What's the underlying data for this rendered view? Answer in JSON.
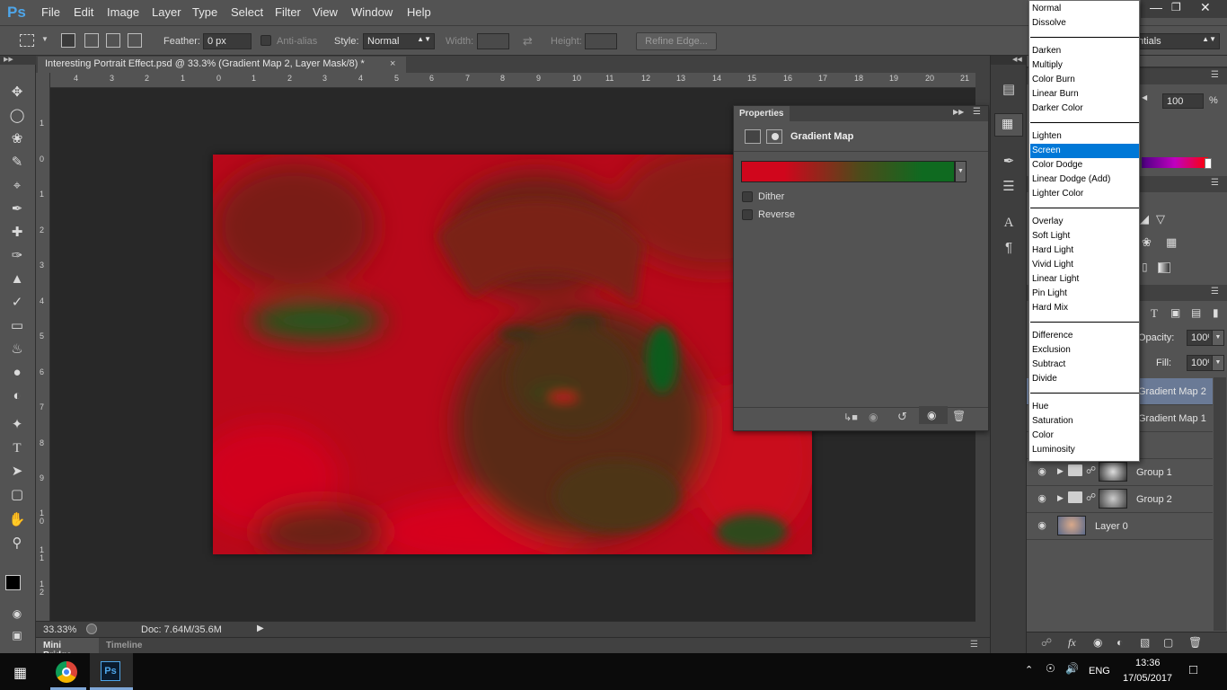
{
  "app": {
    "logo": "Ps",
    "menu": [
      "File",
      "Edit",
      "Image",
      "Layer",
      "Type",
      "Select",
      "Filter",
      "View",
      "Window",
      "Help"
    ]
  },
  "options_bar": {
    "feather_label": "Feather:",
    "feather_value": "0 px",
    "anti_alias_label": "Anti-alias",
    "style_label": "Style:",
    "style_value": "Normal",
    "width_label": "Width:",
    "height_label": "Height:",
    "refine_edge_label": "Refine Edge...",
    "workspace_label": "ntials"
  },
  "document": {
    "tab_title": "Interesting Portrait Effect.psd @ 33.3% (Gradient Map 2, Layer Mask/8) *",
    "close": "×",
    "ruler_top": [
      "4",
      "3",
      "2",
      "1",
      "0",
      "1",
      "2",
      "3",
      "4",
      "5",
      "6",
      "7",
      "8",
      "9",
      "10",
      "11",
      "12",
      "13",
      "14",
      "15",
      "16",
      "17",
      "18",
      "19",
      "20",
      "21"
    ],
    "ruler_left": [
      "1",
      "0",
      "1",
      "2",
      "3",
      "4",
      "5",
      "6",
      "7",
      "8",
      "9",
      "1 0",
      "1 1",
      "1 2"
    ]
  },
  "status": {
    "zoom": "33.33%",
    "doc": "Doc: 7.64M/35.6M"
  },
  "bottom_tabs": [
    "Mini Bridge",
    "Timeline"
  ],
  "properties": {
    "title": "Properties",
    "adjustment": "Gradient Map",
    "dither_label": "Dither",
    "reverse_label": "Reverse",
    "gradient_start": "#d0061c",
    "gradient_end": "#0f6a20"
  },
  "blend_modes": {
    "groups": [
      [
        "Normal",
        "Dissolve"
      ],
      [
        "Darken",
        "Multiply",
        "Color Burn",
        "Linear Burn",
        "Darker Color"
      ],
      [
        "Lighten",
        "Screen",
        "Color Dodge",
        "Linear Dodge (Add)",
        "Lighter Color"
      ],
      [
        "Overlay",
        "Soft Light",
        "Hard Light",
        "Vivid Light",
        "Linear Light",
        "Pin Light",
        "Hard Mix"
      ],
      [
        "Difference",
        "Exclusion",
        "Subtract",
        "Divide"
      ],
      [
        "Hue",
        "Saturation",
        "Color",
        "Luminosity"
      ]
    ],
    "highlighted": "Screen"
  },
  "color_panel": {
    "value": "100",
    "unit": "%"
  },
  "layers": {
    "opacity_label": "Opacity:",
    "opacity_value": "100%",
    "fill_label": "Fill:",
    "fill_value": "100%",
    "items": [
      {
        "name": "Gradient Map 2",
        "selected": true
      },
      {
        "name": "Gradient Map 1",
        "selected": false
      },
      {
        "name": "Group 1",
        "selected": false
      },
      {
        "name": "Group 2",
        "selected": false
      },
      {
        "name": "Layer 0",
        "selected": false
      }
    ],
    "footer_icons": [
      "link-icon",
      "fx-icon",
      "mask-icon",
      "adjustment-icon",
      "folder-icon",
      "new-layer-icon",
      "trash-icon"
    ]
  },
  "taskbar": {
    "language": "ENG",
    "time": "13:36",
    "date": "17/05/2017",
    "apps": [
      "Chrome",
      "Ps"
    ]
  }
}
